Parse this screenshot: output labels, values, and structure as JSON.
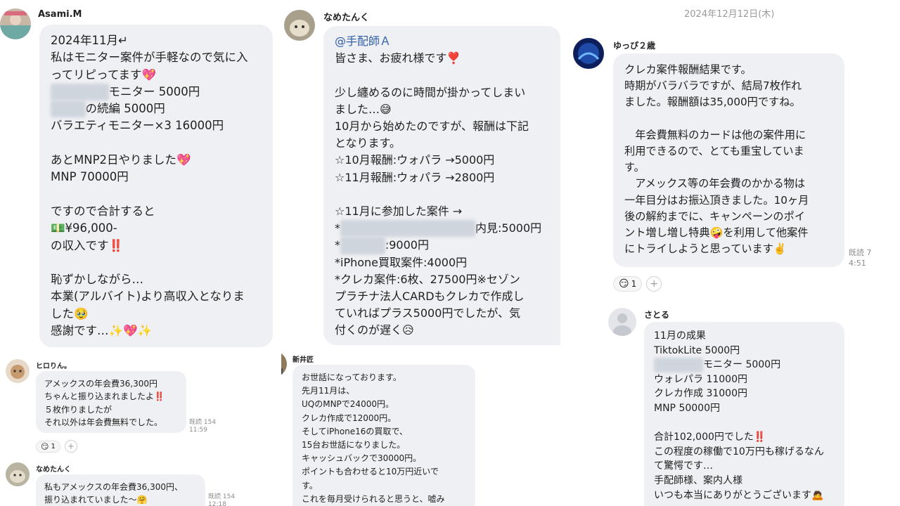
{
  "col1": {
    "sender": "Asami.M",
    "lines": [
      {
        "t": "2024年11月↵"
      },
      {
        "t": "私はモニター案件が手軽なので気に入"
      },
      {
        "t": "ってリピってます💖"
      },
      {
        "b": "五大元素様",
        "t": "モニター 5000円"
      },
      {
        "b": "五大元",
        "t": "の続編 5000円"
      },
      {
        "t": "バラエティモニター×3 16000円"
      },
      {
        "t": " "
      },
      {
        "t": "あとMNP2日やりました💖"
      },
      {
        "t": "MNP 70000円"
      },
      {
        "t": " "
      },
      {
        "t": "ですので合計すると"
      },
      {
        "t": "💵¥96,000-"
      },
      {
        "t": "の収入です‼️"
      },
      {
        "t": " "
      },
      {
        "t": "恥ずかしながら…"
      },
      {
        "t": "本業(アルバイト)より高収入となりま"
      },
      {
        "t": "した🥹"
      },
      {
        "t": "感謝です…✨💖✨"
      }
    ]
  },
  "col1b": {
    "sender": "ヒロりん。",
    "lines": [
      "アメックスの年会費36,300円",
      "ちゃんと振り込まれましたよ‼️",
      "５枚作りましたが",
      "それ以外は年会費無料でした。"
    ],
    "meta": "既読 154\n11:59",
    "reaction_emoji": "😏",
    "reaction_count": "1",
    "add": "+"
  },
  "col1c": {
    "sender": "なめたんく",
    "lines": [
      "私もアメックスの年会費36,300円、",
      "振り込まれていました〜🤗"
    ],
    "meta": "既読 154\n12:18"
  },
  "col2": {
    "sender": "なめたんく",
    "mention": "@手配師Ａ",
    "lines": [
      {
        "t": "皆さま、お疲れ様です❣️"
      },
      {
        "t": " "
      },
      {
        "t": "少し纏めるのに時間が掛かってしまい"
      },
      {
        "t": "ました…😅"
      },
      {
        "t": "10月から始めたのですが、報酬は下記"
      },
      {
        "t": "となります。"
      },
      {
        "t": "☆10月報酬:ウォパラ →5000円"
      },
      {
        "t": "☆11月報酬:ウォパラ →2800円"
      },
      {
        "t": " "
      },
      {
        "t": "☆11月に参加した案件 →"
      },
      {
        "p": "*",
        "b": "ヘッドスパ系のクリニック",
        "t": "内見:5000円"
      },
      {
        "p": "*",
        "b": "ダイアル",
        "t": ":9000円"
      },
      {
        "t": "*iPhone買取案件:4000円"
      },
      {
        "t": "*クレカ案件:6枚、27500円※セゾン"
      },
      {
        "t": "プラチナ法人CARDもクレカで作成し"
      },
      {
        "t": "ていればプラス5000円でしたが、気"
      },
      {
        "t": "付くのが遅く😥"
      }
    ]
  },
  "col2b": {
    "sender": "新井匠",
    "lines": [
      "お世話になっております。",
      "先月11月は、",
      "UQのMNPで24000円。",
      "クレカ作成で12000円。",
      "そしてiPhone16の買取で、",
      "15台お世話になりました。",
      "キャッシュバックで30000円。",
      "ポイントも合わせると10万円近いで",
      "す。",
      "これを毎月受けられると思うと、嘘み"
    ]
  },
  "col3": {
    "date": "2024年12月12日(木)",
    "sender": "ゆっぴ２歳",
    "lines": [
      "クレカ案件報酬結果です。",
      "時期がバラバラですが、結局7枚作れ",
      "ました。報酬額は35,000円ですね。",
      " ",
      "　年会費無料のカードは他の案件用に",
      "利用できるので、とても重宝していま",
      "す。",
      "　アメックス等の年会費のかかる物は",
      "一年目分はお振込頂きました。10ヶ月",
      "後の解約までに、キャンペーンのポイ",
      "ント増し増し特典🤪を利用して他案件",
      "にトライしようと思っています✌️"
    ],
    "meta": "既読 7\n4:51",
    "reaction_emoji": "😏",
    "reaction_count": "1",
    "add": "+"
  },
  "col3b": {
    "sender": "さとる",
    "lines": [
      {
        "t": "11月の成果"
      },
      {
        "t": "TiktokLite 5000円"
      },
      {
        "b": "五大元素様",
        "t": "モニター 5000円"
      },
      {
        "t": "ウォレパラ 11000円"
      },
      {
        "t": "クレカ作成 31000円"
      },
      {
        "t": "MNP 50000円"
      },
      {
        "t": " "
      },
      {
        "t": "合計102,000円でした‼️"
      },
      {
        "t": "この程度の稼働で10万円も稼げるなん"
      },
      {
        "t": "て驚愕です…"
      },
      {
        "t": "手配師様、案内人様"
      },
      {
        "t": "いつも本当にありがとうございます🙇"
      }
    ]
  }
}
